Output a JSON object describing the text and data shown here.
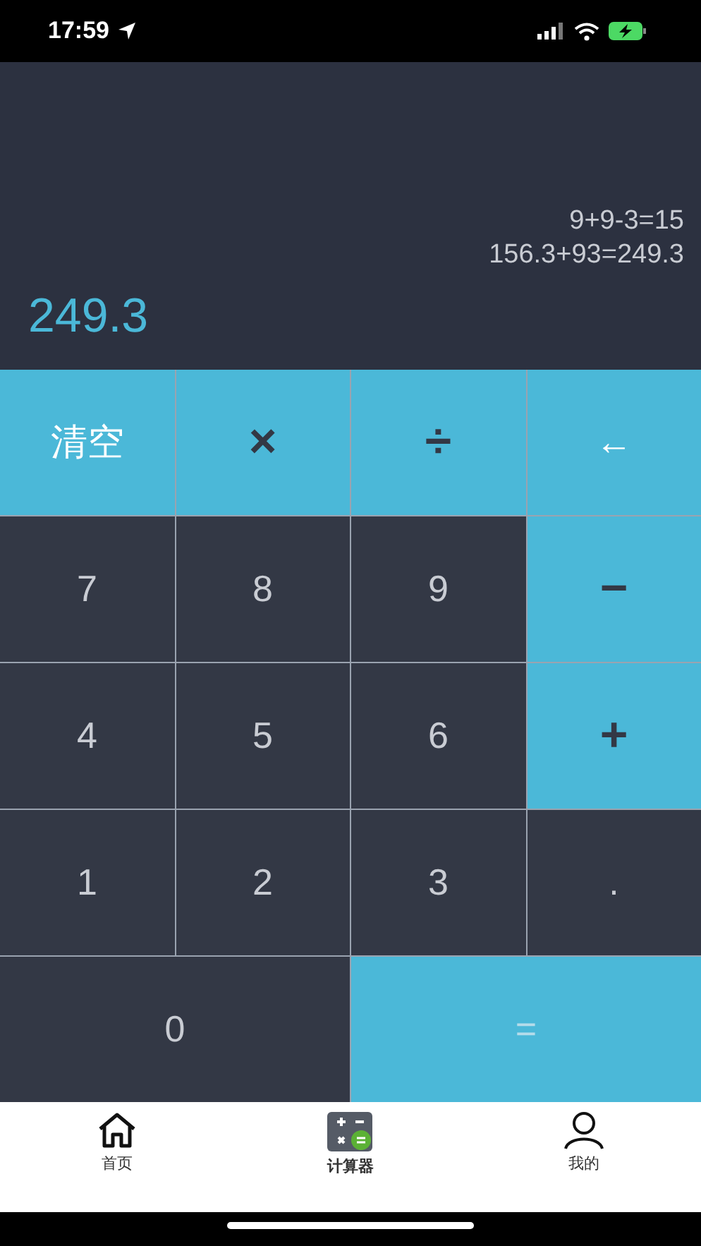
{
  "status_bar": {
    "time": "17:59"
  },
  "display": {
    "history": [
      "9+9-3=15",
      "156.3+93=249.3"
    ],
    "result": "249.3"
  },
  "keys": [
    {
      "label": "清空",
      "kind": "clear"
    },
    {
      "label": "×",
      "kind": "operator"
    },
    {
      "label": "÷",
      "kind": "operator"
    },
    {
      "label": "←",
      "kind": "back"
    },
    {
      "label": "7",
      "kind": "digit"
    },
    {
      "label": "8",
      "kind": "digit"
    },
    {
      "label": "9",
      "kind": "digit"
    },
    {
      "label": "−",
      "kind": "operator"
    },
    {
      "label": "4",
      "kind": "digit"
    },
    {
      "label": "5",
      "kind": "digit"
    },
    {
      "label": "6",
      "kind": "digit"
    },
    {
      "label": "+",
      "kind": "operator"
    },
    {
      "label": "1",
      "kind": "digit"
    },
    {
      "label": "2",
      "kind": "digit"
    },
    {
      "label": "3",
      "kind": "digit"
    },
    {
      "label": ".",
      "kind": "digit"
    },
    {
      "label": "0",
      "kind": "digit",
      "wide": true
    },
    {
      "label": "=",
      "kind": "equals",
      "wide": true
    }
  ],
  "tabs": [
    {
      "label": "首页",
      "kind": "home",
      "selected": false
    },
    {
      "label": "计算器",
      "kind": "calculator",
      "selected": true
    },
    {
      "label": "我的",
      "kind": "profile",
      "selected": false
    }
  ]
}
